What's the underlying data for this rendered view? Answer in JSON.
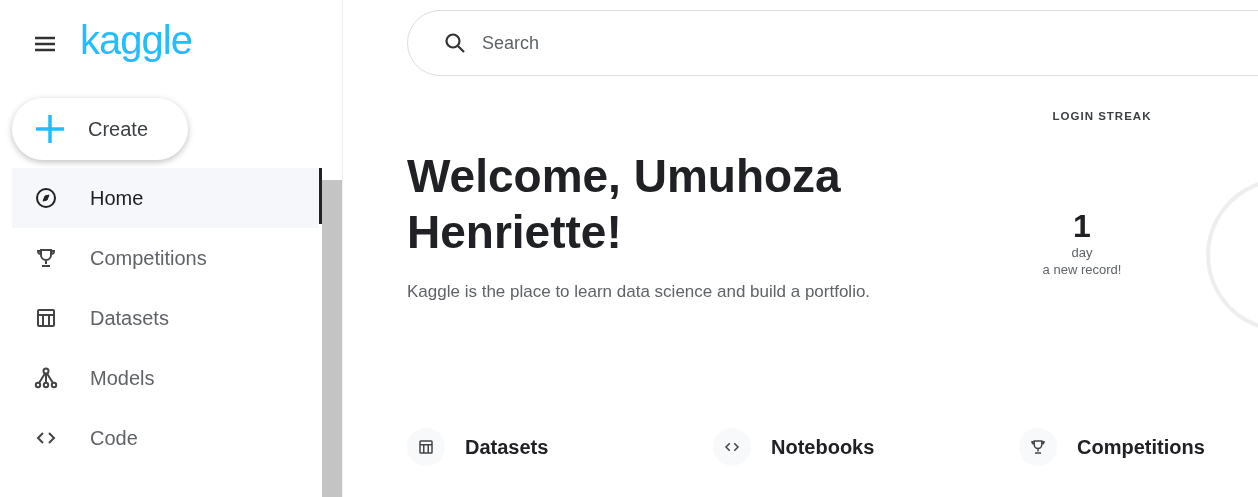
{
  "header": {
    "logo": "kaggle"
  },
  "create_button": {
    "label": "Create"
  },
  "sidebar": {
    "items": [
      {
        "kind": "home",
        "label": "Home",
        "selected": true
      },
      {
        "kind": "trophy",
        "label": "Competitions",
        "selected": false
      },
      {
        "kind": "table",
        "label": "Datasets",
        "selected": false
      },
      {
        "kind": "models",
        "label": "Models",
        "selected": false
      },
      {
        "kind": "code",
        "label": "Code",
        "selected": false
      }
    ]
  },
  "search": {
    "placeholder": "Search"
  },
  "welcome": {
    "title": "Welcome, Umuhoza Henriette!",
    "subtitle": "Kaggle is the place to learn data science and build a portfolio."
  },
  "streak": {
    "label": "LOGIN STREAK",
    "value": "1",
    "unit": "day",
    "note": "a new record!"
  },
  "sections": [
    {
      "kind": "table",
      "label": "Datasets"
    },
    {
      "kind": "code",
      "label": "Notebooks"
    },
    {
      "kind": "trophy",
      "label": "Competitions"
    }
  ]
}
